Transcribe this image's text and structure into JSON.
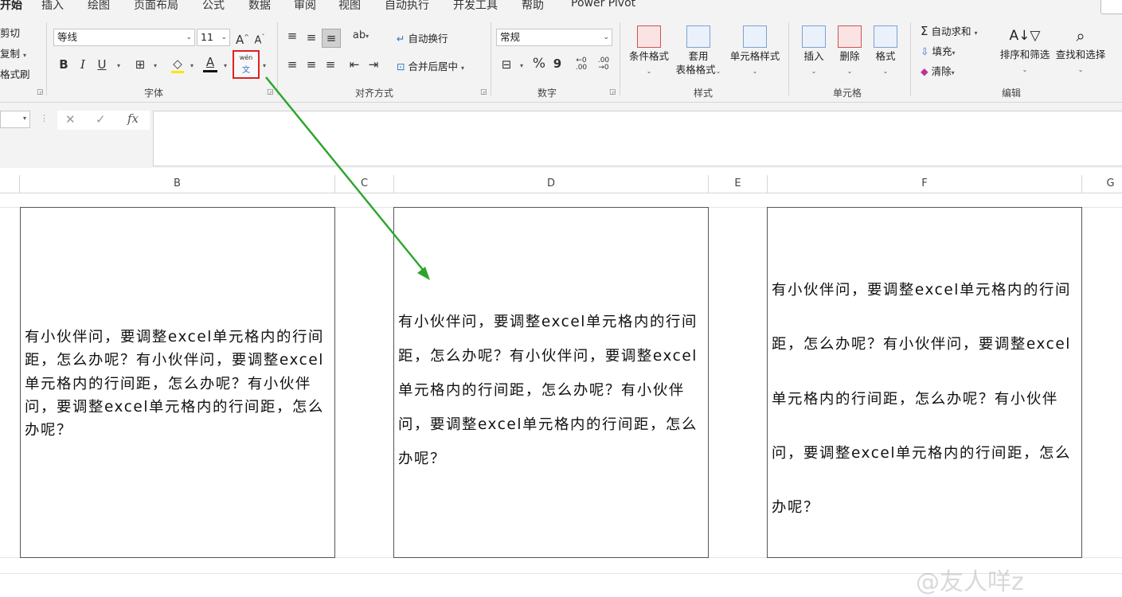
{
  "tabs": [
    "开始",
    "插入",
    "绘图",
    "页面布局",
    "公式",
    "数据",
    "审阅",
    "视图",
    "自动执行",
    "开发工具",
    "帮助",
    "Power Pivot"
  ],
  "clipboard": {
    "cut": "剪切",
    "copy": "复制",
    "format_painter": "格式刷"
  },
  "font": {
    "name": "等线",
    "size": "11",
    "grow": "A",
    "shrink": "A",
    "bold": "B",
    "italic": "I",
    "underline": "U",
    "font_color_letter": "A",
    "phonetic_top": "wén",
    "phonetic_bottom": "文",
    "group_label": "字体"
  },
  "alignment": {
    "wrap": "自动换行",
    "merge": "合并后居中",
    "group_label": "对齐方式"
  },
  "number": {
    "format": "常规",
    "percent": "%",
    "comma": "9",
    "inc_dec": "←0 .00",
    "dec_dec": ".00 →0",
    "group_label": "数字"
  },
  "styles": {
    "conditional": "条件格式",
    "table_format_line1": "套用",
    "table_format_line2": "表格格式",
    "cell_styles": "单元格样式",
    "group_label": "样式"
  },
  "cells": {
    "insert": "插入",
    "delete": "删除",
    "format": "格式",
    "group_label": "单元格"
  },
  "editing": {
    "autosum": "自动求和",
    "fill": "填充",
    "clear": "清除",
    "sort_filter": "排序和筛选",
    "find_select": "查找和选择",
    "group_label": "编辑"
  },
  "formula_bar": {
    "cancel": "✕",
    "enter": "✓",
    "fx": "fx"
  },
  "columns": [
    "B",
    "C",
    "D",
    "E",
    "F",
    "G"
  ],
  "cell_text": "有小伙伴问，要调整excel单元格内的行间距，怎么办呢？有小伙伴问，要调整excel单元格内的行间距，怎么办呢？有小伙伴问，要调整excel单元格内的行间距，怎么办呢？",
  "watermark": "@友人咩z",
  "colors": {
    "ribbon_bg": "#f3f3f3",
    "highlight_box": "#e02020",
    "arrow": "#2aa52a"
  }
}
